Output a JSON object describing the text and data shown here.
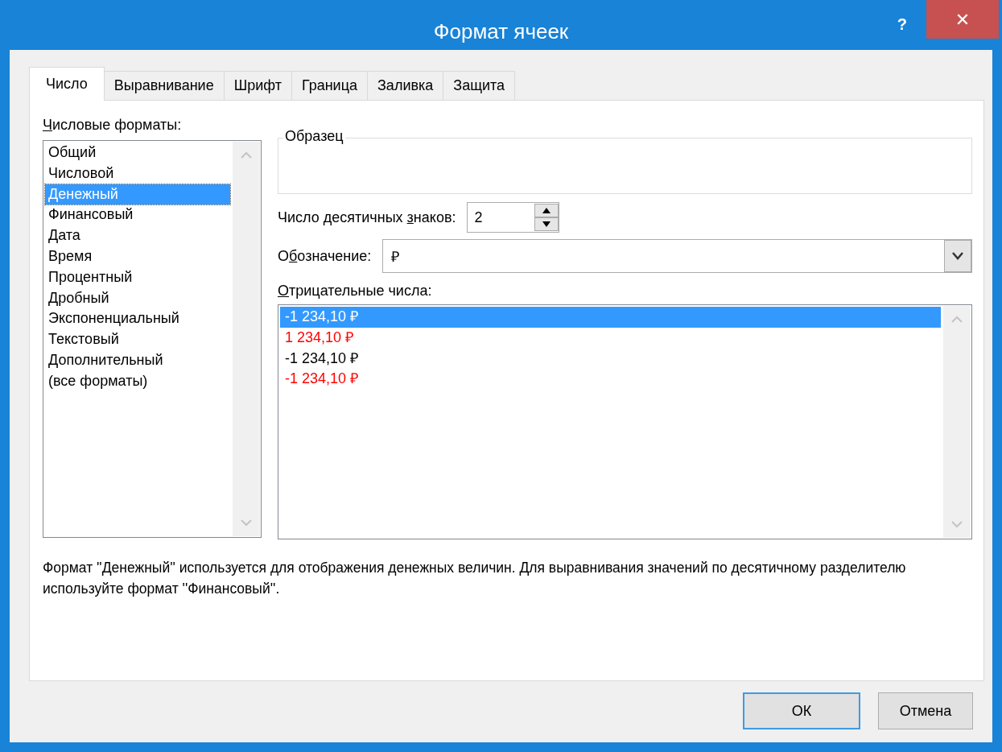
{
  "window": {
    "title": "Формат ячеек",
    "help": "?",
    "close": "✕"
  },
  "tabs": [
    {
      "label": "Число",
      "selected": true
    },
    {
      "label": "Выравнивание",
      "selected": false
    },
    {
      "label": "Шрифт",
      "selected": false
    },
    {
      "label": "Граница",
      "selected": false
    },
    {
      "label": "Заливка",
      "selected": false
    },
    {
      "label": "Защита",
      "selected": false
    }
  ],
  "formats": {
    "label": {
      "key": "Ч",
      "post": "исловые форматы:"
    },
    "items": [
      {
        "label": "Общий",
        "selected": false
      },
      {
        "label": "Числовой",
        "selected": false
      },
      {
        "label": "Денежный",
        "selected": true
      },
      {
        "label": "Финансовый",
        "selected": false
      },
      {
        "label": "Дата",
        "selected": false
      },
      {
        "label": "Время",
        "selected": false
      },
      {
        "label": "Процентный",
        "selected": false
      },
      {
        "label": "Дробный",
        "selected": false
      },
      {
        "label": "Экспоненциальный",
        "selected": false
      },
      {
        "label": "Текстовый",
        "selected": false
      },
      {
        "label": "Дополнительный",
        "selected": false
      },
      {
        "label": "(все форматы)",
        "selected": false
      }
    ]
  },
  "sample": {
    "title": "Образец"
  },
  "decimals": {
    "label": {
      "pre": "Число десятичных ",
      "key": "з",
      "post": "наков:"
    },
    "value": "2"
  },
  "symbol": {
    "label": {
      "pre": "О",
      "key": "б",
      "post": "означение:"
    },
    "value": "₽"
  },
  "negative": {
    "label": {
      "key": "О",
      "post": "трицательные числа:"
    },
    "items": [
      {
        "label": "-1 234,10 ₽",
        "color": "#ffffff",
        "selected": true
      },
      {
        "label": "1 234,10 ₽",
        "color": "#ff0000",
        "selected": false
      },
      {
        "label": "-1 234,10 ₽",
        "color": "#000000",
        "selected": false
      },
      {
        "label": "-1 234,10 ₽",
        "color": "#ff0000",
        "selected": false
      }
    ]
  },
  "description": "Формат ''Денежный'' используется для отображения денежных величин. Для выравнивания значений по десятичному разделителю используйте формат ''Финансовый''.",
  "buttons": [
    {
      "label": "ОК",
      "kind": "default"
    },
    {
      "label": "Отмена",
      "kind": "normal"
    }
  ]
}
